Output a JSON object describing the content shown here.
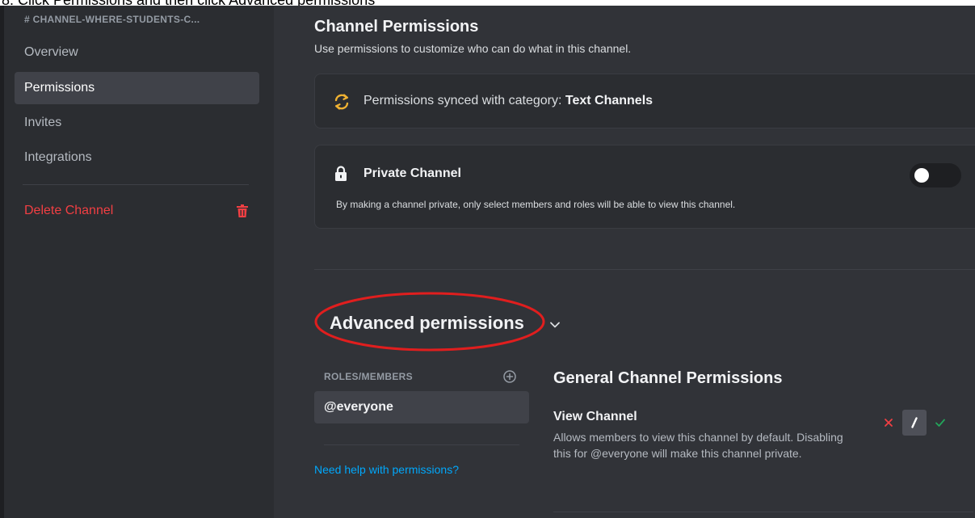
{
  "instruction": "8. Click Permissions and then click Advanced permissions",
  "sidebar": {
    "channel_title": "# CHANNEL-WHERE-STUDENTS-C...",
    "items": [
      {
        "label": "Overview"
      },
      {
        "label": "Permissions",
        "active": true
      },
      {
        "label": "Invites"
      },
      {
        "label": "Integrations"
      }
    ],
    "delete_label": "Delete Channel"
  },
  "main": {
    "title": "Channel Permissions",
    "subtitle": "Use permissions to customize who can do what in this channel.",
    "sync": {
      "prefix": "Permissions synced with category: ",
      "category": "Text Channels"
    },
    "private_channel": {
      "title": "Private Channel",
      "description": "By making a channel private, only select members and roles will be able to view this channel.",
      "enabled": false
    },
    "advanced": {
      "title": "Advanced permissions",
      "roles_header": "ROLES/MEMBERS",
      "selected_role": "@everyone",
      "help_link": "Need help with permissions?",
      "section_title": "General Channel Permissions",
      "permission": {
        "title": "View Channel",
        "description": "Allows members to view this channel by default. Disabling this for @everyone will make this channel private.",
        "state": "neutral"
      }
    }
  },
  "colors": {
    "background": "#313338",
    "sidebar": "#2b2d31",
    "danger": "#f23f43",
    "success": "#23a55a",
    "link": "#00a8fc",
    "sync_icon": "#f0b232",
    "annotation": "#e01e1e"
  },
  "icons": [
    "sync-icon",
    "lock-icon",
    "trash-icon",
    "chevron-down-icon",
    "add-circle-icon",
    "x-icon",
    "slash-icon",
    "check-icon"
  ]
}
